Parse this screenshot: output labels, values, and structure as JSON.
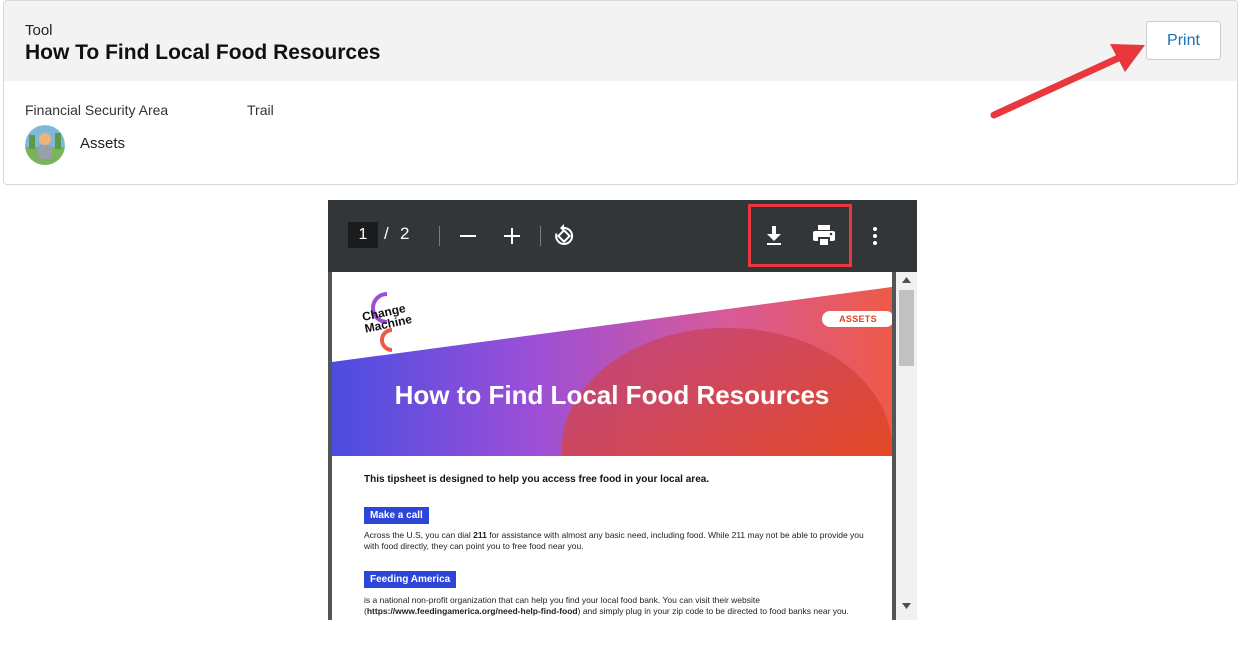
{
  "header": {
    "eyebrow": "Tool",
    "title": "How To Find Local Food Resources",
    "print_label": "Print"
  },
  "meta": {
    "financial_area_label": "Financial Security Area",
    "trail_label": "Trail",
    "area_value": "Assets"
  },
  "pdf_toolbar": {
    "current_page": "1",
    "separator": "/",
    "total_pages": "2"
  },
  "pdf_page": {
    "logo_line1": "Change",
    "logo_line2": "Machine",
    "badge": "ASSETS",
    "heading": "How to Find Local Food Resources",
    "intro": "This tipsheet is designed to help you access free food in your local area.",
    "section1_title": "Make a call",
    "section1_text_a": "Across the U.S, you can dial ",
    "section1_bold": "211",
    "section1_text_b": " for assistance with almost any basic need, including food. While 211 may not be able to provide you with food directly, they can point you to free food near you.",
    "section2_title": "Feeding America",
    "section2_text_a": "is a national non-profit organization that can help you find your local food bank. You can visit their website (",
    "section2_url": "https://www.feedingamerica.org/need-help-find-food",
    "section2_text_b": ") and simply plug in your zip code to be directed to food banks near you."
  },
  "colors": {
    "accent_red": "#e8373d",
    "link_blue": "#1a6fb0",
    "chip_blue": "#2d46d8",
    "toolbar_dark": "#323639"
  }
}
